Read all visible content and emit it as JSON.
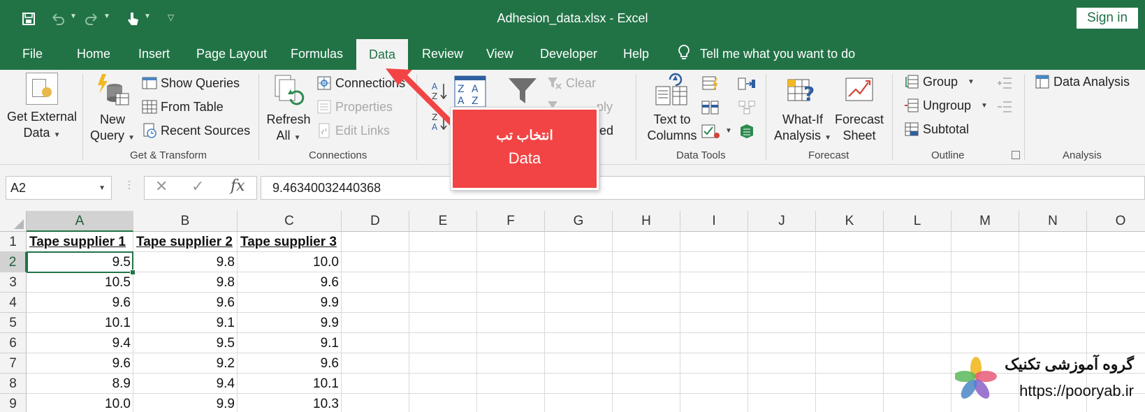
{
  "titlebar": {
    "doc_title": "Adhesion_data.xlsx  -  Excel",
    "sign_in": "Sign in",
    "icons": [
      "save-icon",
      "undo-icon",
      "redo-icon",
      "touch-mode-icon",
      "customize-qat-icon"
    ]
  },
  "tabs": [
    "File",
    "Home",
    "Insert",
    "Page Layout",
    "Formulas",
    "Data",
    "Review",
    "View",
    "Developer",
    "Help"
  ],
  "active_tab": "Data",
  "tell_me": "Tell me what you want to do",
  "ribbon": {
    "get_external_data": {
      "line1": "Get External",
      "line2": "Data"
    },
    "new_query": {
      "line1": "New",
      "line2": "Query"
    },
    "show_queries": "Show Queries",
    "from_table": "From Table",
    "recent_sources": "Recent Sources",
    "group_get_transform": "Get & Transform",
    "refresh_all": {
      "line1": "Refresh",
      "line2": "All"
    },
    "connections": "Connections",
    "properties": "Properties",
    "edit_links": "Edit Links",
    "group_connections": "Connections",
    "clear": "Clear",
    "reapply_fragment": "ply",
    "advanced_fragment": "nced",
    "text_to_columns": {
      "line1": "Text to",
      "line2": "Columns"
    },
    "group_data_tools": "Data Tools",
    "what_if": {
      "line1": "What-If",
      "line2": "Analysis"
    },
    "forecast_sheet": {
      "line1": "Forecast",
      "line2": "Sheet"
    },
    "group_forecast": "Forecast",
    "group_btn": "Group",
    "ungroup_btn": "Ungroup",
    "subtotal_btn": "Subtotal",
    "group_outline": "Outline",
    "data_analysis": "Data Analysis",
    "group_analysis": "Analysis"
  },
  "formula_bar": {
    "name_box": "A2",
    "formula": "9.46340032440368"
  },
  "columns": [
    "A",
    "B",
    "C",
    "D",
    "E",
    "F",
    "G",
    "H",
    "I",
    "J",
    "K",
    "L",
    "M",
    "N",
    "O"
  ],
  "rows": [
    "1",
    "2",
    "3",
    "4",
    "5",
    "6",
    "7",
    "8",
    "9"
  ],
  "headers": [
    "Tape supplier 1",
    "Tape supplier 2",
    "Tape supplier 3"
  ],
  "data": [
    [
      "9.5",
      "9.8",
      "10.0"
    ],
    [
      "10.5",
      "9.8",
      "9.6"
    ],
    [
      "9.6",
      "9.6",
      "9.9"
    ],
    [
      "10.1",
      "9.1",
      "9.9"
    ],
    [
      "9.4",
      "9.5",
      "9.1"
    ],
    [
      "9.6",
      "9.2",
      "9.6"
    ],
    [
      "8.9",
      "9.4",
      "10.1"
    ],
    [
      "10.0",
      "9.9",
      "10.3"
    ]
  ],
  "callout": {
    "line1": "انتخاب تب",
    "line2": "Data",
    "color": "#f24444"
  },
  "watermark": {
    "name": "گروه آموزشی تکنیک",
    "url": "https://pooryab.ir"
  },
  "colors": {
    "excel_green": "#217346",
    "ribbon_bg": "#f3f3f3"
  }
}
